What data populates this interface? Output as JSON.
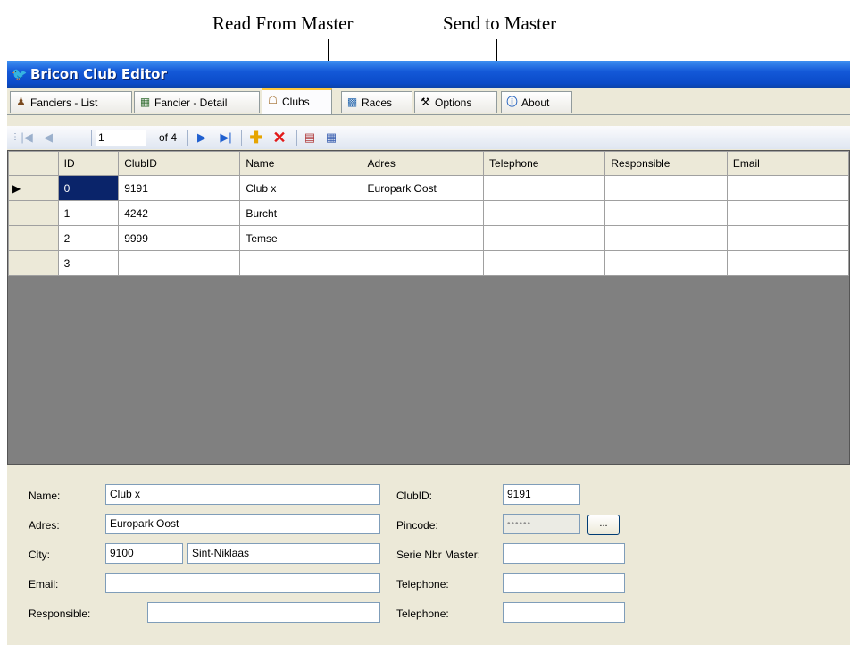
{
  "annotations": {
    "read_from_master": "Read From Master",
    "send_to_master": "Send to Master"
  },
  "window": {
    "title": "Bricon Club Editor"
  },
  "tabs": [
    {
      "label": "Fanciers - List",
      "icon": "people-icon"
    },
    {
      "label": "Fancier - Detail",
      "icon": "person-detail-icon"
    },
    {
      "label": "Clubs",
      "icon": "clubs-icon",
      "active": true
    },
    {
      "label": "Races",
      "icon": "races-icon"
    },
    {
      "label": "Options",
      "icon": "tools-icon"
    },
    {
      "label": "About",
      "icon": "info-icon"
    }
  ],
  "navigator": {
    "position": "1",
    "of_label": "of 4"
  },
  "grid": {
    "columns": [
      "ID",
      "ClubID",
      "Name",
      "Adres",
      "Telephone",
      "Responsible",
      "Email"
    ],
    "rows": [
      [
        "0",
        "9191",
        "Club x",
        "Europark Oost",
        "",
        "",
        ""
      ],
      [
        "1",
        "4242",
        "Burcht",
        "",
        "",
        "",
        ""
      ],
      [
        "2",
        "9999",
        "Temse",
        "",
        "",
        "",
        ""
      ],
      [
        "3",
        "",
        "",
        "",
        "",
        "",
        ""
      ]
    ]
  },
  "form": {
    "name_label": "Name:",
    "name_value": "Club x",
    "adres_label": "Adres:",
    "adres_value": "Europark Oost",
    "city_label": "City:",
    "zip_value": "9100",
    "city_value": "Sint-Niklaas",
    "email_label": "Email:",
    "email_value": "",
    "responsible_label": "Responsible:",
    "responsible_value": "",
    "clubid_label": "ClubID:",
    "clubid_value": "9191",
    "pincode_label": "Pincode:",
    "pincode_value": "••••••",
    "pincode_button": "...",
    "serie_label": "Serie Nbr Master:",
    "serie_value": "",
    "telephone1_label": "Telephone:",
    "telephone1_value": "",
    "telephone2_label": "Telephone:",
    "telephone2_value": ""
  }
}
